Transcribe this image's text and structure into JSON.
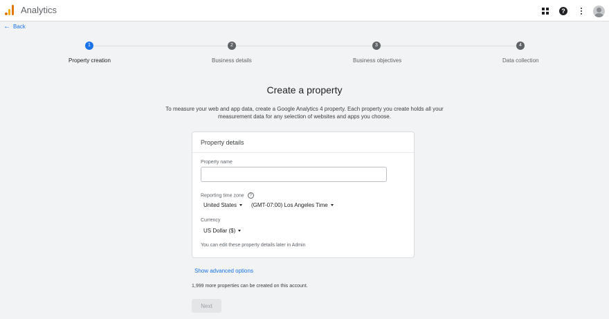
{
  "header": {
    "app_title": "Analytics"
  },
  "nav": {
    "back_label": "Back"
  },
  "stepper": {
    "steps": [
      {
        "number": "1",
        "label": "Property creation",
        "active": true
      },
      {
        "number": "2",
        "label": "Business details",
        "active": false
      },
      {
        "number": "3",
        "label": "Business objectives",
        "active": false
      },
      {
        "number": "4",
        "label": "Data collection",
        "active": false
      }
    ]
  },
  "main": {
    "title": "Create a property",
    "intro_line1": "To measure your web and app data, create a Google Analytics 4 property. Each property you create holds all your",
    "intro_line2": "measurement data for any selection of websites and apps you choose."
  },
  "card": {
    "heading": "Property details",
    "property_name_label": "Property name",
    "property_name_value": "",
    "time_zone_label": "Reporting time zone",
    "help_symbol": "?",
    "country_value": "United States",
    "time_zone_value": "(GMT-07:00) Los Angeles Time",
    "currency_label": "Currency",
    "currency_value": "US Dollar ($)",
    "note": "You can edit these property details later in Admin"
  },
  "footer": {
    "advanced_link": "Show advanced options",
    "count_text": "1,999 more properties can be created on this account.",
    "next_label": "Next"
  },
  "colors": {
    "accent": "#1a73e8",
    "logo_orange": "#e37400",
    "logo_yellow": "#f9ab00"
  },
  "icons": [
    "analytics-logo-icon",
    "apps-grid-icon",
    "help-icon",
    "more-vert-icon",
    "avatar",
    "arrow-back-icon",
    "caret-down-icon"
  ]
}
